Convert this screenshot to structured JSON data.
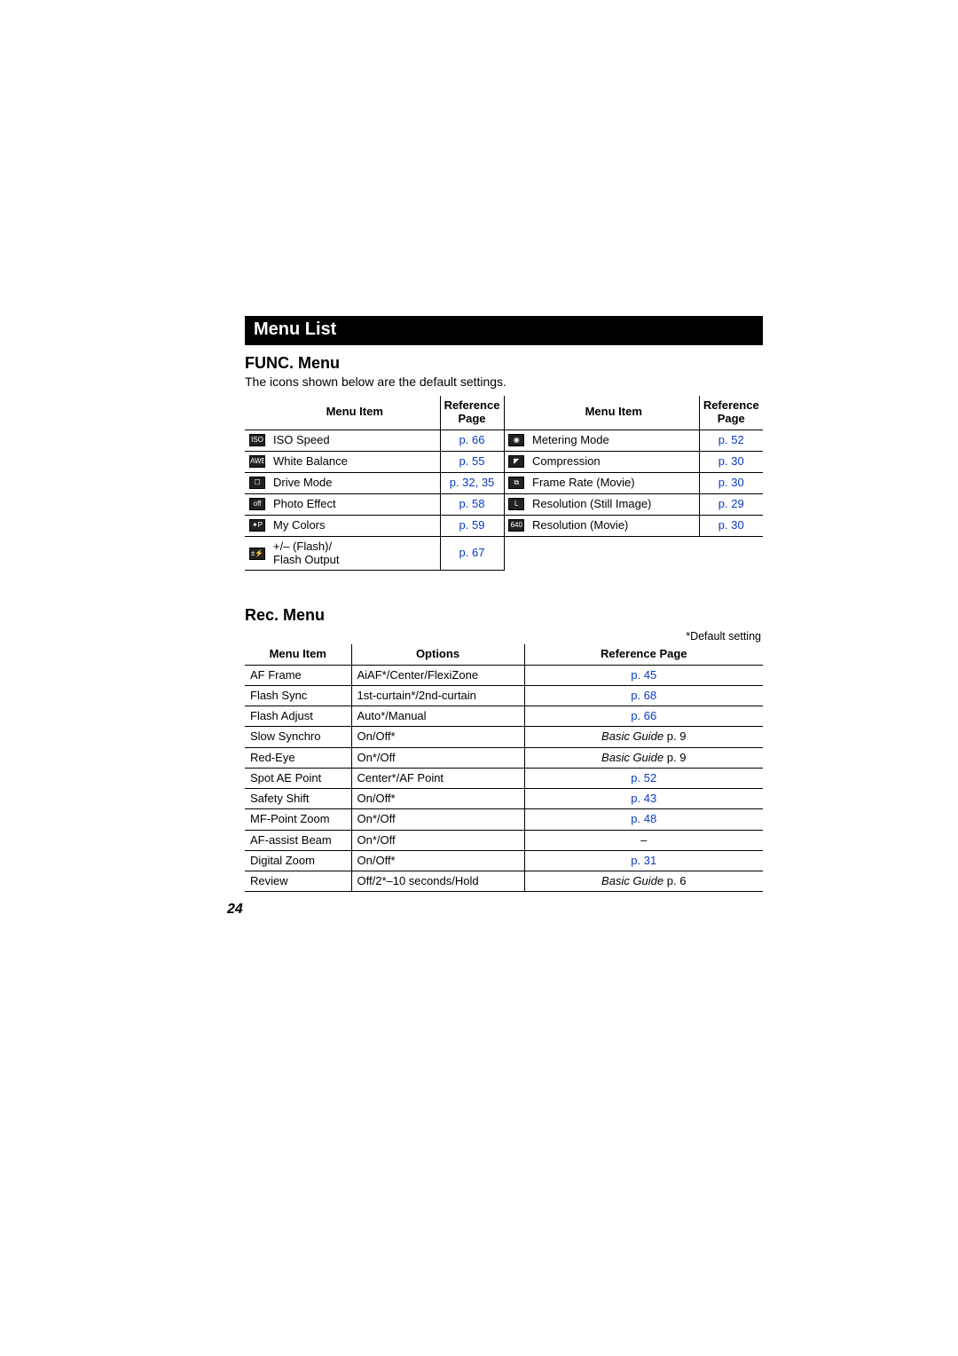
{
  "banner": "Menu List",
  "func": {
    "title": "FUNC. Menu",
    "subtitle": "The icons shown below are the default settings.",
    "headers": {
      "menuItem": "Menu Item",
      "refPage": "Reference Page"
    },
    "left": [
      {
        "icon": "ISO",
        "label": "ISO Speed",
        "ref": "p. 66"
      },
      {
        "icon": "AWB",
        "label": "White Balance",
        "ref": "p. 55"
      },
      {
        "icon": "☐",
        "label": "Drive Mode",
        "ref": "p. 32, 35"
      },
      {
        "icon": "off",
        "label": "Photo Effect",
        "ref": "p. 58"
      },
      {
        "icon": "✦P",
        "label": "My Colors",
        "ref": "p. 59"
      },
      {
        "icon": "±⚡",
        "label": "+/– (Flash)/\nFlash Output",
        "ref": "p. 67"
      }
    ],
    "right": [
      {
        "icon": "◉",
        "label": "Metering Mode",
        "ref": "p. 52"
      },
      {
        "icon": "◤",
        "label": "Compression",
        "ref": "p. 30"
      },
      {
        "icon": "⧉",
        "label": "Frame Rate (Movie)",
        "ref": "p. 30"
      },
      {
        "icon": "L",
        "label": "Resolution (Still Image)",
        "ref": "p. 29"
      },
      {
        "icon": "640",
        "label": "Resolution (Movie)",
        "ref": "p. 30"
      }
    ]
  },
  "rec": {
    "title": "Rec. Menu",
    "defaultNote": "*Default setting",
    "headers": {
      "menuItem": "Menu Item",
      "options": "Options",
      "refPage": "Reference Page"
    },
    "rows": [
      {
        "item": "AF Frame",
        "options": "AiAF*/Center/FlexiZone",
        "ref": "p. 45",
        "refType": "link"
      },
      {
        "item": "Flash Sync",
        "options": "1st-curtain*/2nd-curtain",
        "ref": "p. 68",
        "refType": "link"
      },
      {
        "item": "Flash Adjust",
        "options": "Auto*/Manual",
        "ref": "p. 66",
        "refType": "link"
      },
      {
        "item": "Slow Synchro",
        "options": "On/Off*",
        "ref": "Basic Guide p. 9",
        "refType": "guide"
      },
      {
        "item": "Red-Eye",
        "options": "On*/Off",
        "ref": "Basic Guide p. 9",
        "refType": "guide"
      },
      {
        "item": "Spot AE Point",
        "options": "Center*/AF Point",
        "ref": "p. 52",
        "refType": "link"
      },
      {
        "item": "Safety Shift",
        "options": "On/Off*",
        "ref": "p. 43",
        "refType": "link"
      },
      {
        "item": "MF-Point Zoom",
        "options": "On*/Off",
        "ref": "p. 48",
        "refType": "link"
      },
      {
        "item": "AF-assist Beam",
        "options": "On*/Off",
        "ref": "–",
        "refType": "dash"
      },
      {
        "item": "Digital Zoom",
        "options": "On/Off*",
        "ref": "p. 31",
        "refType": "link"
      },
      {
        "item": "Review",
        "options": "Off/2*–10 seconds/Hold",
        "ref": "Basic Guide p. 6",
        "refType": "guide"
      }
    ]
  },
  "pageNumber": "24",
  "chart_data": {
    "type": "table",
    "tables": [
      {
        "name": "FUNC. Menu",
        "columns": [
          "Menu Item",
          "Reference Page"
        ],
        "rows": [
          [
            "ISO Speed",
            "p. 66"
          ],
          [
            "White Balance",
            "p. 55"
          ],
          [
            "Drive Mode",
            "p. 32, 35"
          ],
          [
            "Photo Effect",
            "p. 58"
          ],
          [
            "My Colors",
            "p. 59"
          ],
          [
            "+/– (Flash)/Flash Output",
            "p. 67"
          ],
          [
            "Metering Mode",
            "p. 52"
          ],
          [
            "Compression",
            "p. 30"
          ],
          [
            "Frame Rate (Movie)",
            "p. 30"
          ],
          [
            "Resolution (Still Image)",
            "p. 29"
          ],
          [
            "Resolution (Movie)",
            "p. 30"
          ]
        ]
      },
      {
        "name": "Rec. Menu",
        "columns": [
          "Menu Item",
          "Options",
          "Reference Page"
        ],
        "rows": [
          [
            "AF Frame",
            "AiAF*/Center/FlexiZone",
            "p. 45"
          ],
          [
            "Flash Sync",
            "1st-curtain*/2nd-curtain",
            "p. 68"
          ],
          [
            "Flash Adjust",
            "Auto*/Manual",
            "p. 66"
          ],
          [
            "Slow Synchro",
            "On/Off*",
            "Basic Guide p. 9"
          ],
          [
            "Red-Eye",
            "On*/Off",
            "Basic Guide p. 9"
          ],
          [
            "Spot AE Point",
            "Center*/AF Point",
            "p. 52"
          ],
          [
            "Safety Shift",
            "On/Off*",
            "p. 43"
          ],
          [
            "MF-Point Zoom",
            "On*/Off",
            "p. 48"
          ],
          [
            "AF-assist Beam",
            "On*/Off",
            "–"
          ],
          [
            "Digital Zoom",
            "On/Off*",
            "p. 31"
          ],
          [
            "Review",
            "Off/2*–10 seconds/Hold",
            "Basic Guide p. 6"
          ]
        ]
      }
    ]
  }
}
